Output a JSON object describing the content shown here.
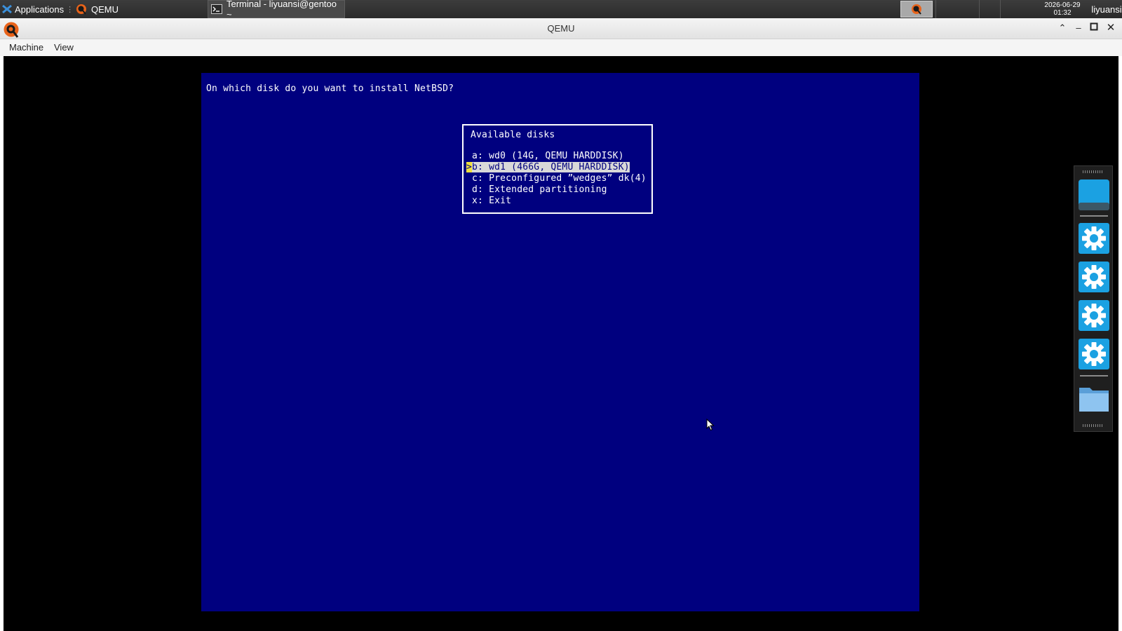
{
  "taskbar": {
    "applications_label": "Applications",
    "tasks": [
      {
        "label": "QEMU",
        "icon": "qemu-icon"
      },
      {
        "label": "Terminal - liyuansi@gentoo ~",
        "icon": "terminal-icon"
      }
    ],
    "clock": {
      "date": "2026-06-29",
      "time": "01:32"
    },
    "user": "liyuansi"
  },
  "window": {
    "title": "QEMU",
    "controls": [
      "shade",
      "minimize",
      "maximize",
      "close"
    ]
  },
  "menubar": {
    "items": [
      "Machine",
      "View"
    ]
  },
  "guest": {
    "question": "On which disk do you want to install NetBSD?",
    "menu_title": "Available disks",
    "options": [
      {
        "text": "a: wd0 (14G, QEMU HARDDISK)",
        "selected": false
      },
      {
        "text": "b: wd1 (466G, QEMU HARDDISK)",
        "selected": true
      },
      {
        "text": "c: Preconfigured ”wedges” dk(4)",
        "selected": false
      },
      {
        "text": "d: Extended partitioning",
        "selected": false
      },
      {
        "text": "x: Exit",
        "selected": false
      }
    ],
    "selection_marker": ">"
  },
  "dock": {
    "items": [
      "display-icon",
      "gear-icon",
      "gear-icon",
      "gear-icon",
      "gear-icon",
      "folder-icon"
    ]
  },
  "colors": {
    "guest_background": "#00007f",
    "selection_highlight": "#d8d8d8",
    "selection_marker": "#f0e040",
    "dock_accent": "#1ba1e2"
  }
}
